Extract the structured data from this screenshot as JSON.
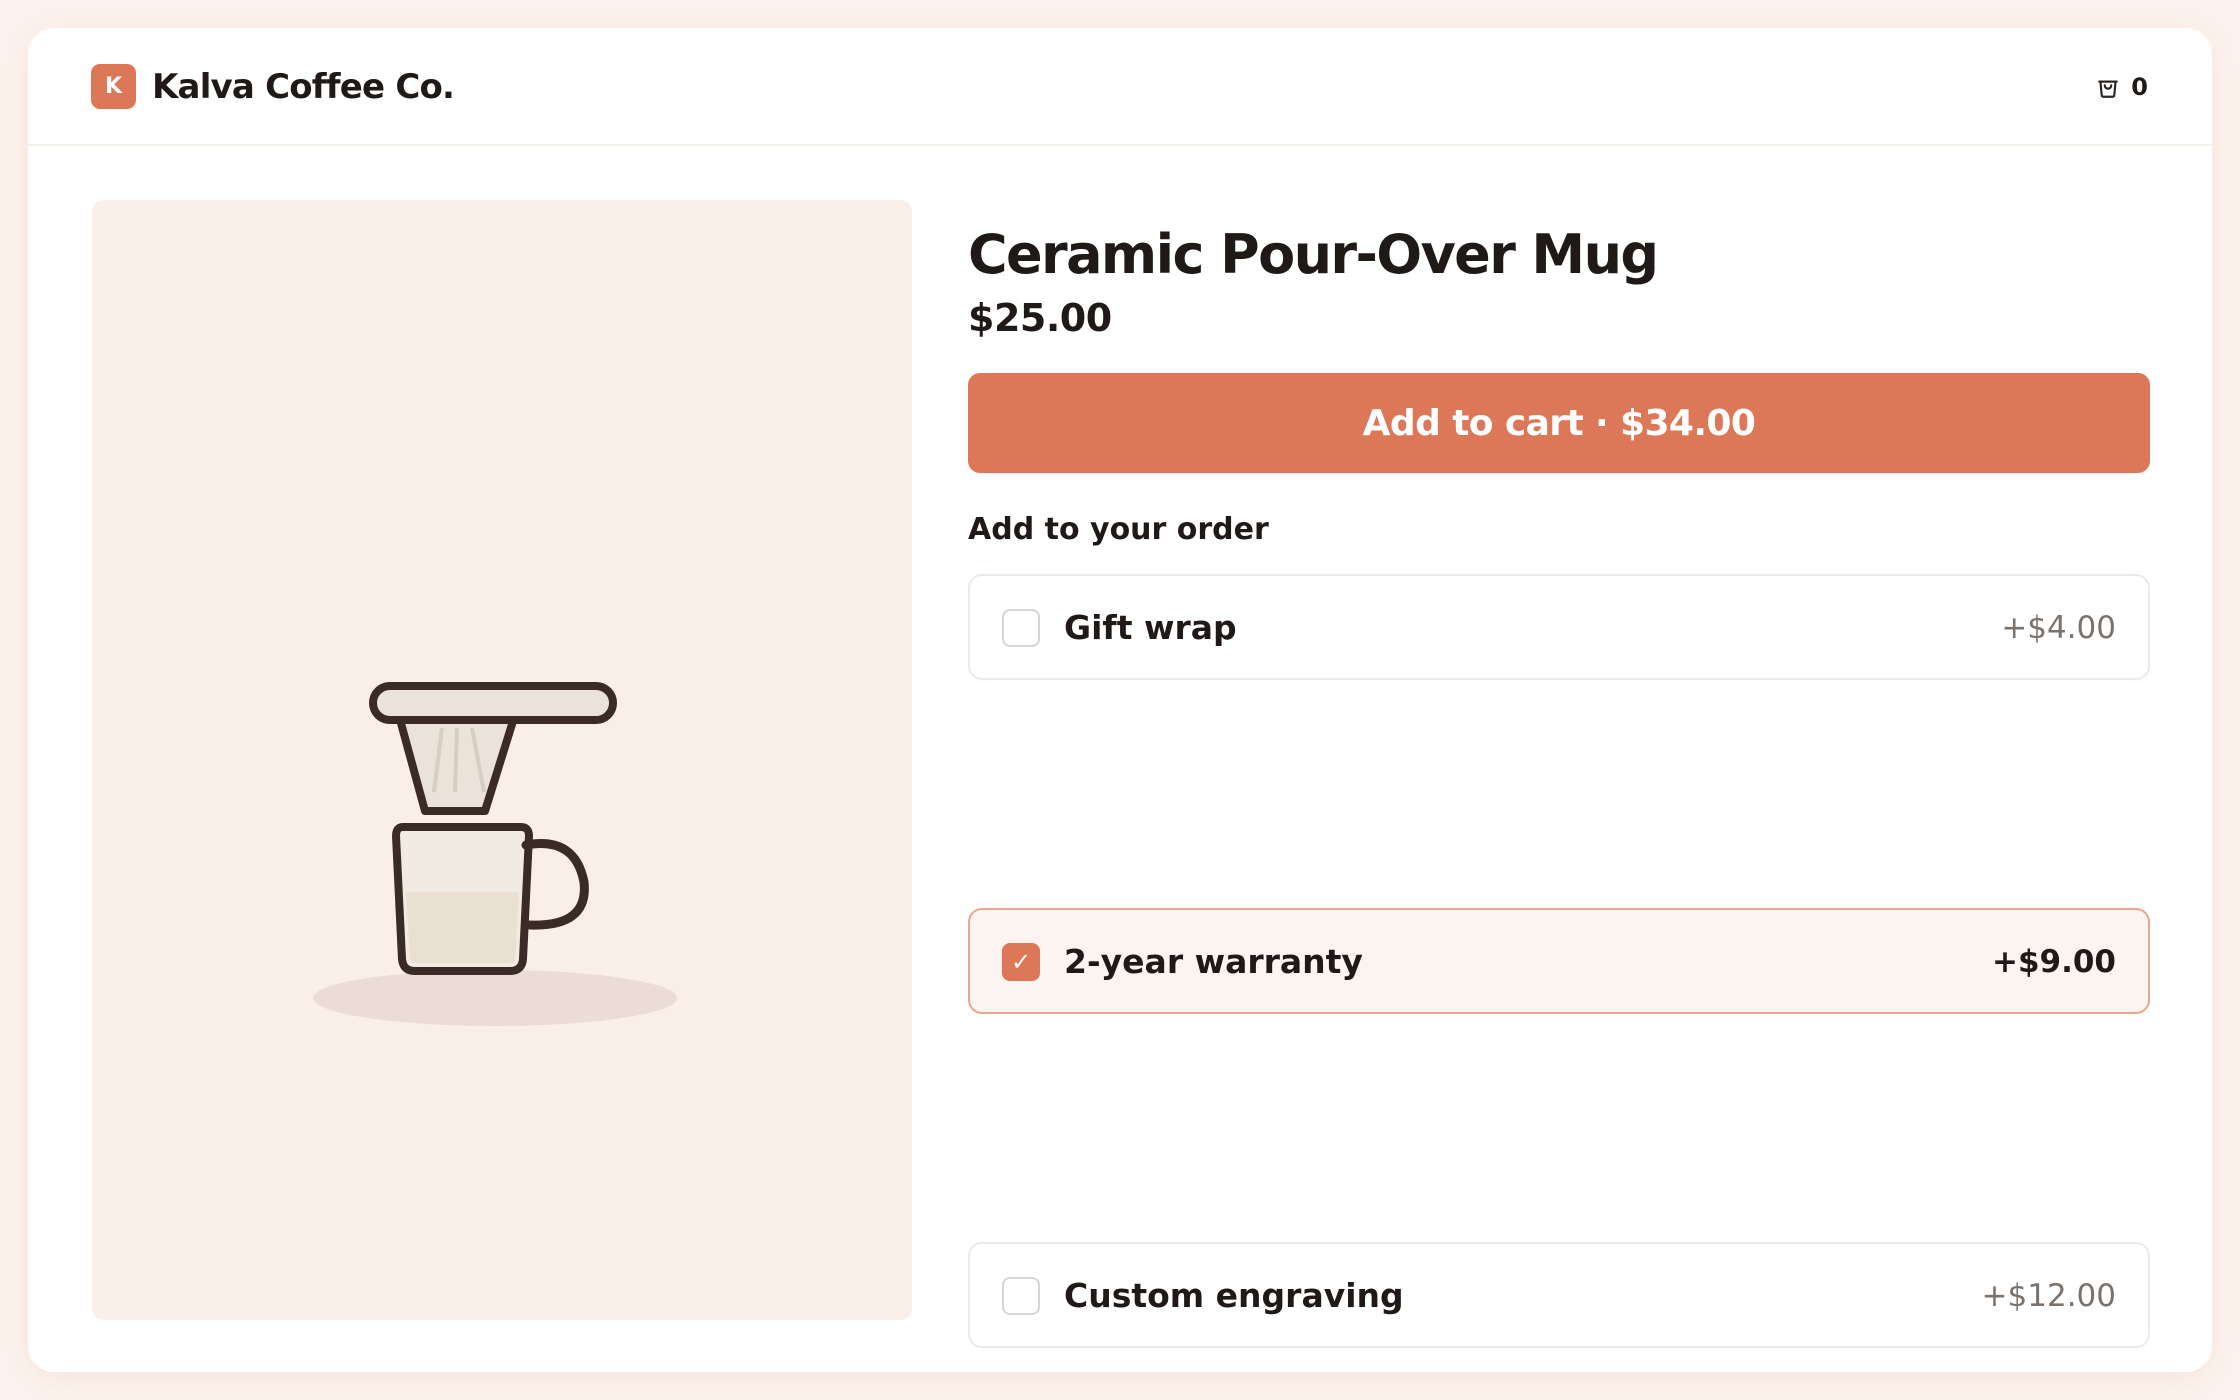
{
  "header": {
    "logo_letter": "K",
    "brand_name": "Kalva Coffee Co.",
    "cart_icon": "shopping-bag-icon",
    "cart_count": "0"
  },
  "product": {
    "image_alt": "pour-over-mug-illustration",
    "title": "Ceramic Pour-Over Mug",
    "price": "$25.00",
    "add_to_cart_label": "Add to cart · $34.00"
  },
  "addons": {
    "section_label": "Add to your order",
    "options": [
      {
        "label": "Gift wrap",
        "price": "+$4.00",
        "selected": false
      },
      {
        "label": "2-year warranty",
        "price": "+$9.00",
        "selected": true
      },
      {
        "label": "Custom engraving",
        "price": "+$12.00",
        "selected": false
      }
    ]
  },
  "colors": {
    "accent": "#dc7757",
    "page_background": "#fcf3ee",
    "image_panel": "#faeee8",
    "selected_border": "#e9a58d"
  }
}
